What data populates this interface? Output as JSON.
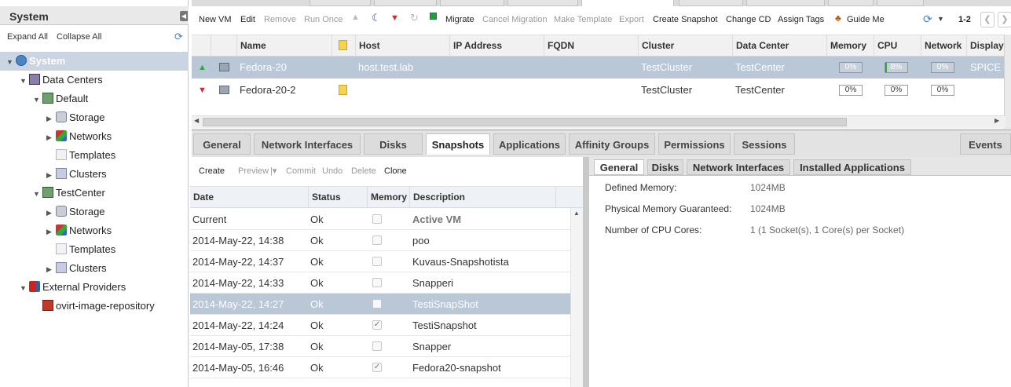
{
  "left_panel": {
    "title": "System",
    "expand_all": "Expand All",
    "collapse_all": "Collapse All",
    "tree": [
      {
        "label": "System",
        "level": 0,
        "arrow": "▼",
        "icon": "globe-icon",
        "selected": true
      },
      {
        "label": "Data Centers",
        "level": 1,
        "arrow": "▼",
        "icon": "datacenters-icon"
      },
      {
        "label": "Default",
        "level": 2,
        "arrow": "▼",
        "icon": "datacenter-icon"
      },
      {
        "label": "Storage",
        "level": 3,
        "arrow": "▶",
        "icon": "storage-icon"
      },
      {
        "label": "Networks",
        "level": 3,
        "arrow": "▶",
        "icon": "network-icon"
      },
      {
        "label": "Templates",
        "level": 3,
        "arrow": "",
        "icon": "template-icon"
      },
      {
        "label": "Clusters",
        "level": 3,
        "arrow": "▶",
        "icon": "cluster-icon"
      },
      {
        "label": "TestCenter",
        "level": 2,
        "arrow": "▼",
        "icon": "datacenter-icon"
      },
      {
        "label": "Storage",
        "level": 3,
        "arrow": "▶",
        "icon": "storage-icon"
      },
      {
        "label": "Networks",
        "level": 3,
        "arrow": "▶",
        "icon": "network-icon"
      },
      {
        "label": "Templates",
        "level": 3,
        "arrow": "",
        "icon": "template-icon"
      },
      {
        "label": "Clusters",
        "level": 3,
        "arrow": "▶",
        "icon": "cluster-icon"
      },
      {
        "label": "External Providers",
        "level": 1,
        "arrow": "▼",
        "icon": "truck-icon"
      },
      {
        "label": "ovirt-image-repository",
        "level": 2,
        "arrow": "",
        "icon": "repository-icon"
      }
    ]
  },
  "toolbar": {
    "new_vm": "New VM",
    "edit": "Edit",
    "remove": "Remove",
    "run_once": "Run Once",
    "migrate": "Migrate",
    "cancel_migration": "Cancel Migration",
    "make_template": "Make Template",
    "export": "Export",
    "create_snapshot": "Create Snapshot",
    "change_cd": "Change CD",
    "assign_tags": "Assign Tags",
    "guide_me": "Guide Me",
    "pager": "1-2"
  },
  "grid": {
    "columns": [
      "Name",
      "Host",
      "IP Address",
      "FQDN",
      "Cluster",
      "Data Center",
      "Memory",
      "CPU",
      "Network",
      "Display"
    ],
    "rows": [
      {
        "status": "up",
        "name": "Fedora-20",
        "host": "host.test.lab",
        "ip": "",
        "fqdn": "",
        "cluster": "TestCluster",
        "datacenter": "TestCenter",
        "memory": "0%",
        "cpu": "8%",
        "network": "0%",
        "display": "SPICE",
        "selected": true,
        "comment": false
      },
      {
        "status": "down",
        "name": "Fedora-20-2",
        "host": "",
        "ip": "",
        "fqdn": "",
        "cluster": "TestCluster",
        "datacenter": "TestCenter",
        "memory": "0%",
        "cpu": "0%",
        "network": "0%",
        "display": "",
        "selected": false,
        "comment": true
      }
    ]
  },
  "subtabs": [
    "General",
    "Network Interfaces",
    "Disks",
    "Snapshots",
    "Applications",
    "Affinity Groups",
    "Permissions",
    "Sessions"
  ],
  "events_tab": "Events",
  "snapshots": {
    "toolbar": {
      "create": "Create",
      "preview": "Preview",
      "commit": "Commit",
      "undo": "Undo",
      "delete": "Delete",
      "clone": "Clone"
    },
    "columns": [
      "Date",
      "Status",
      "Memory",
      "Description"
    ],
    "rows": [
      {
        "date": "Current",
        "status": "Ok",
        "memory": false,
        "description": "Active VM",
        "bold": true
      },
      {
        "date": "2014-May-22, 14:38",
        "status": "Ok",
        "memory": false,
        "description": "poo"
      },
      {
        "date": "2014-May-22, 14:37",
        "status": "Ok",
        "memory": false,
        "description": "Kuvaus-Snapshotista"
      },
      {
        "date": "2014-May-22, 14:33",
        "status": "Ok",
        "memory": false,
        "description": "Snapperi"
      },
      {
        "date": "2014-May-22, 14:27",
        "status": "Ok",
        "memory": false,
        "description": "TestiSnapShot",
        "selected": true
      },
      {
        "date": "2014-May-22, 14:24",
        "status": "Ok",
        "memory": true,
        "description": "TestiSnapshot"
      },
      {
        "date": "2014-May-05, 17:38",
        "status": "Ok",
        "memory": false,
        "description": "Snapper"
      },
      {
        "date": "2014-May-05, 16:46",
        "status": "Ok",
        "memory": true,
        "description": "Fedora20-snapshot"
      }
    ]
  },
  "detail": {
    "tabs": [
      "General",
      "Disks",
      "Network Interfaces",
      "Installed Applications"
    ],
    "fields": [
      {
        "label": "Defined Memory:",
        "value": "1024MB"
      },
      {
        "label": "Physical Memory Guaranteed:",
        "value": "1024MB"
      },
      {
        "label": "Number of CPU Cores:",
        "value": "1 (1 Socket(s), 1 Core(s) per Socket)"
      }
    ]
  },
  "colors": {
    "selection": "#b9c7d6",
    "tree_selection": "#cbd4e1",
    "up_arrow": "#2eaa3c",
    "down_arrow": "#d9262b",
    "link_blue": "#3b87c8"
  }
}
